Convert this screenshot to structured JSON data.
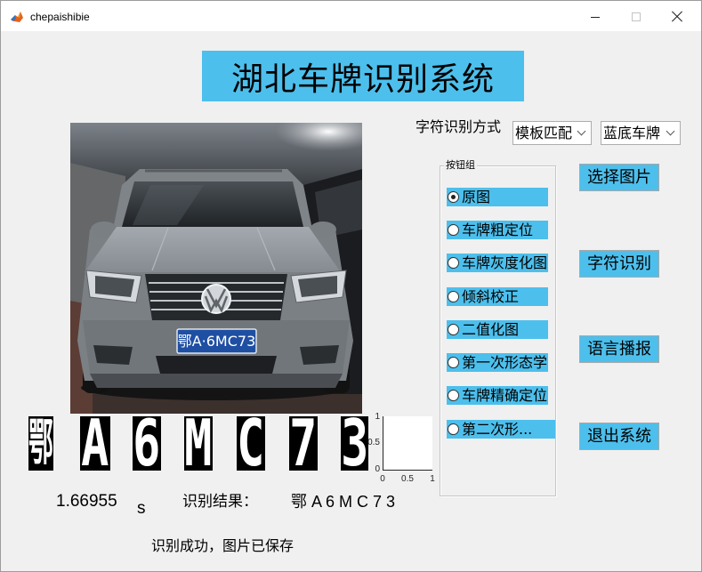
{
  "window": {
    "title": "chepaishibie"
  },
  "icons": {
    "app": "matlab-icon",
    "minimize": "minimize-icon",
    "maximize": "maximize-icon",
    "close": "close-icon",
    "dropdown": "chevron-down-icon"
  },
  "header": {
    "title": "湖北车牌识别系统"
  },
  "recognition_method": {
    "label": "字符识别方式",
    "method_selected": "模板匹配",
    "plate_type_selected": "蓝底车牌"
  },
  "photo": {
    "plate_text": "鄂A·6MC73"
  },
  "segmented_chars": [
    "鄂",
    "A",
    "6",
    "M",
    "C",
    "7",
    "3"
  ],
  "axes": {
    "ytick_labels": [
      "1",
      "0.5",
      "0"
    ],
    "xtick_labels": [
      "0",
      "0.5",
      "1"
    ]
  },
  "result": {
    "elapsed_time": "1.66955",
    "time_unit": "s",
    "label": "识别结果：",
    "value": "鄂 A 6 M C 7 3"
  },
  "status": "识别成功，图片已保存",
  "button_group": {
    "title": "按钮组",
    "items": [
      {
        "label": "原图",
        "selected": true
      },
      {
        "label": "车牌粗定位",
        "selected": false
      },
      {
        "label": "车牌灰度化图",
        "selected": false
      },
      {
        "label": "倾斜校正",
        "selected": false
      },
      {
        "label": "二值化图",
        "selected": false
      },
      {
        "label": "第一次形态学",
        "selected": false
      },
      {
        "label": "车牌精确定位",
        "selected": false
      },
      {
        "label": "第二次形...",
        "selected": false
      }
    ]
  },
  "actions": {
    "select_image": "选择图片",
    "recognize": "字符识别",
    "voice": "语言播报",
    "exit": "退出系统"
  },
  "colors": {
    "accent": "#4dbfec",
    "background": "#f0f0f0",
    "plate_blue": "#1f4fa3"
  }
}
